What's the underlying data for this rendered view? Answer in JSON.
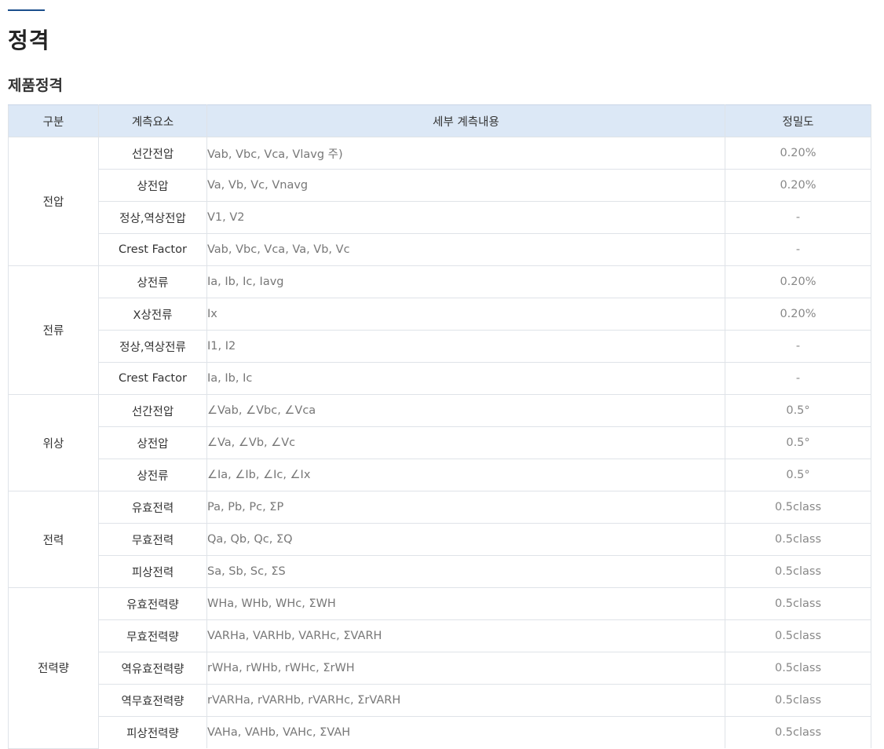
{
  "header": {
    "page_title": "정격",
    "section_title": "제품정격"
  },
  "table": {
    "columns": [
      "구분",
      "계측요소",
      "세부 계측내용",
      "정밀도"
    ],
    "groups": [
      {
        "name": "전압",
        "rows": [
          {
            "element": "선간전압",
            "detail": "Vab, Vbc, Vca, Vlavg 주)",
            "precision": "0.20%"
          },
          {
            "element": "상전압",
            "detail": "Va, Vb, Vc, Vnavg",
            "precision": "0.20%"
          },
          {
            "element": "정상,역상전압",
            "detail": "V1, V2",
            "precision": "-"
          },
          {
            "element": "Crest Factor",
            "detail": "Vab, Vbc, Vca, Va, Vb, Vc",
            "precision": "-"
          }
        ]
      },
      {
        "name": "전류",
        "rows": [
          {
            "element": "상전류",
            "detail": "Ia, Ib, Ic, Iavg",
            "precision": "0.20%"
          },
          {
            "element": "X상전류",
            "detail": "Ix",
            "precision": "0.20%"
          },
          {
            "element": "정상,역상전류",
            "detail": "I1, I2",
            "precision": "-"
          },
          {
            "element": "Crest Factor",
            "detail": "Ia, Ib, Ic",
            "precision": "-"
          }
        ]
      },
      {
        "name": "위상",
        "rows": [
          {
            "element": "선간전압",
            "detail": "∠Vab, ∠Vbc, ∠Vca",
            "precision": "0.5°"
          },
          {
            "element": "상전압",
            "detail": "∠Va, ∠Vb, ∠Vc",
            "precision": "0.5°"
          },
          {
            "element": "상전류",
            "detail": "∠Ia, ∠Ib, ∠Ic, ∠Ix",
            "precision": "0.5°"
          }
        ]
      },
      {
        "name": "전력",
        "rows": [
          {
            "element": "유효전력",
            "detail": "Pa, Pb, Pc, ΣP",
            "precision": "0.5class"
          },
          {
            "element": "무효전력",
            "detail": "Qa, Qb, Qc, ΣQ",
            "precision": "0.5class"
          },
          {
            "element": "피상전력",
            "detail": "Sa, Sb, Sc, ΣS",
            "precision": "0.5class"
          }
        ]
      },
      {
        "name": "전력량",
        "rows": [
          {
            "element": "유효전력량",
            "detail": "WHa, WHb, WHc, ΣWH",
            "precision": "0.5class"
          },
          {
            "element": "무효전력량",
            "detail": "VARHa, VARHb, VARHc, ΣVARH",
            "precision": "0.5class"
          },
          {
            "element": "역유효전력량",
            "detail": "rWHa, rWHb, rWHc, ΣrWH",
            "precision": "0.5class"
          },
          {
            "element": "역무효전력량",
            "detail": "rVARHa, rVARHb, rVARHc, ΣrVARH",
            "precision": "0.5class"
          },
          {
            "element": "피상전력량",
            "detail": "VAHa, VAHb, VAHc, ΣVAH",
            "precision": "0.5class"
          }
        ]
      }
    ]
  },
  "colors": {
    "header_bg": "#dce8f6",
    "accent": "#1a4e8c",
    "border": "#dfe3e8"
  }
}
